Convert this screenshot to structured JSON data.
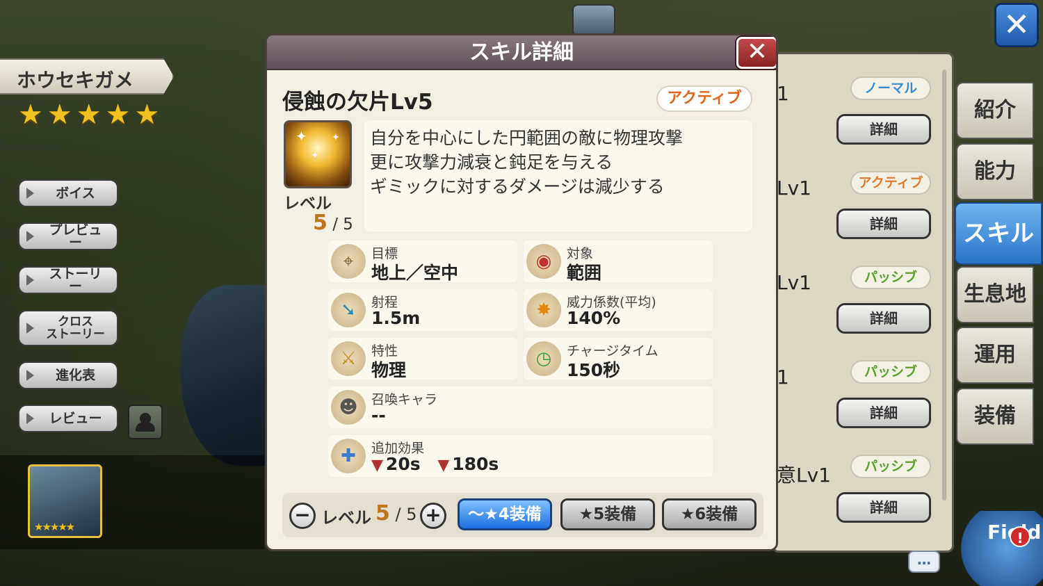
{
  "character": {
    "name": "ホウセキガメ",
    "stars": 5
  },
  "side_menu": [
    {
      "label": "ボイス"
    },
    {
      "label": "プレビュー"
    },
    {
      "label": "ストーリー"
    },
    {
      "label": "クロス\nストーリー"
    },
    {
      "label": "進化表"
    },
    {
      "label": "レビュー"
    }
  ],
  "modal": {
    "title": "スキル詳細",
    "close_label": "✕",
    "skill_name": "侵蝕の欠片Lv5",
    "skill_type": "アクティブ",
    "level_label": "レベル",
    "level_current": "5",
    "level_max": "/ 5",
    "description": [
      "自分を中心にした円範囲の敵に物理攻撃",
      "更に攻撃力減衰と鈍足を与える",
      "ギミックに対するダメージは減少する"
    ],
    "stats": {
      "target": {
        "label": "目標",
        "value": "地上／空中",
        "icon": "crosshair-icon"
      },
      "object": {
        "label": "対象",
        "value": "範囲",
        "icon": "area-icon"
      },
      "range": {
        "label": "射程",
        "value": "1.5m",
        "icon": "arrow-icon"
      },
      "power": {
        "label": "威力係数(平均)",
        "value": "140%",
        "icon": "burst-icon"
      },
      "trait": {
        "label": "特性",
        "value": "物理",
        "icon": "sword-icon"
      },
      "charge": {
        "label": "チャージタイム",
        "value": "150秒",
        "icon": "clock-icon"
      },
      "summon": {
        "label": "召喚キャラ",
        "value": "--",
        "icon": "summon-icon"
      },
      "extra": {
        "label": "追加効果",
        "effect1": "20s",
        "effect2": "180s",
        "icon": "sword-plus-icon"
      }
    },
    "footer": {
      "minus": "−",
      "plus": "+",
      "level_label": "レベル",
      "level_current": "5",
      "level_max": "/ 5",
      "equip_buttons": [
        "〜★4装備",
        "★5装備",
        "★6装備"
      ],
      "selected_equip": 0
    }
  },
  "skill_list": [
    {
      "name": "1",
      "type": "ノーマル",
      "type_class": "normal",
      "detail": "詳細"
    },
    {
      "name": "Lv1",
      "type": "アクティブ",
      "type_class": "active",
      "detail": "詳細"
    },
    {
      "name": "Lv1",
      "type": "パッシブ",
      "type_class": "passive",
      "detail": "詳細"
    },
    {
      "name": "1",
      "type": "パッシブ",
      "type_class": "passive",
      "detail": "詳細"
    },
    {
      "name": "意Lv1",
      "type": "パッシブ",
      "type_class": "passive",
      "detail": "詳細"
    }
  ],
  "tabs": [
    {
      "label": "紹介"
    },
    {
      "label": "能力"
    },
    {
      "label": "スキル",
      "selected": true
    },
    {
      "label": "生息地"
    },
    {
      "label": "運用"
    },
    {
      "label": "装備"
    }
  ],
  "field_label": "Field",
  "close_label": "✕",
  "chat_label": "…",
  "colors": {
    "accent_blue": "#2a74c8",
    "active_orange": "#e0661e",
    "passive_green": "#5aa02a",
    "normal_blue": "#3a8ad0",
    "level_gold": "#c0741a"
  }
}
